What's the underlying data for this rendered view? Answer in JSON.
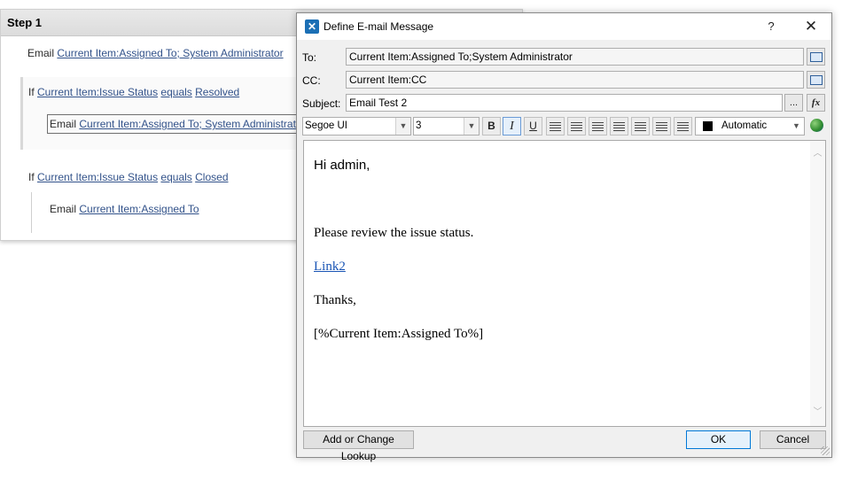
{
  "workflow": {
    "step_title": "Step 1",
    "line1": {
      "prefix": "Email",
      "link": "Current Item:Assigned To; System Administrator"
    },
    "cond1": {
      "prefix": "If",
      "field": "Current Item:Issue Status",
      "op": "equals",
      "value": "Resolved"
    },
    "line2": {
      "prefix": "Email",
      "link": "Current Item:Assigned To; System Administrator"
    },
    "cond2": {
      "prefix": "If",
      "field": "Current Item:Issue Status",
      "op": "equals",
      "value": "Closed"
    },
    "line3": {
      "prefix": "Email",
      "link": "Current Item:Assigned To"
    }
  },
  "dialog": {
    "title": "Define E-mail Message",
    "help_glyph": "?",
    "close_glyph": "✕",
    "to_label": "To:",
    "to_value": "Current Item:Assigned To;System Administrator",
    "cc_label": "CC:",
    "cc_value": "Current Item:CC",
    "subject_label": "Subject:",
    "subject_value": "Email Test 2",
    "subject_more": "...",
    "subject_fx": "fx",
    "toolbar": {
      "font": "Segoe UI",
      "size": "3",
      "bold": "B",
      "italic": "I",
      "underline": "U",
      "color_label": "Automatic"
    },
    "body": {
      "greeting": "Hi admin,",
      "line1": "Please review the issue status.",
      "link": "Link2",
      "thanks": "Thanks,",
      "signature": "[%Current Item:Assigned To%]"
    },
    "buttons": {
      "lookup": "Add or Change Lookup",
      "ok": "OK",
      "cancel": "Cancel"
    }
  }
}
